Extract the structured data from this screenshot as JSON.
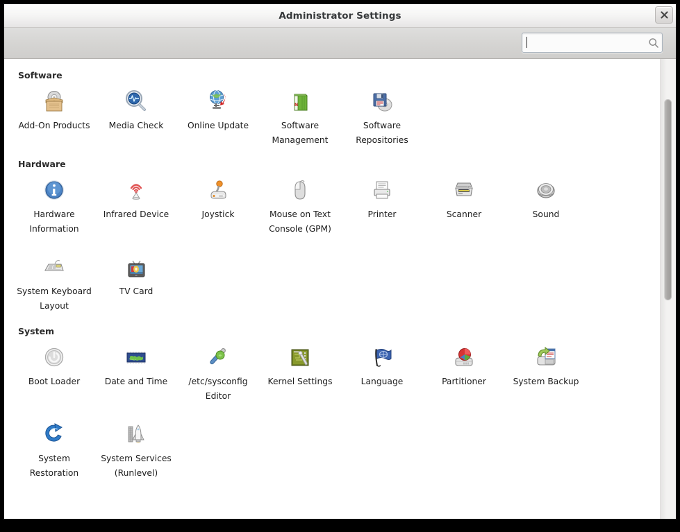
{
  "window": {
    "title": "Administrator Settings",
    "close_label": "x"
  },
  "toolbar": {
    "search": {
      "value": "",
      "placeholder": "",
      "icon": "search-icon"
    }
  },
  "sections": [
    {
      "id": "software",
      "title": "Software",
      "items": [
        {
          "label": "Add-On Products",
          "icon": "package-box-cd-icon"
        },
        {
          "label": "Media Check",
          "icon": "magnifier-pulse-icon"
        },
        {
          "label": "Online Update",
          "icon": "globe-download-icon"
        },
        {
          "label": "Software Management",
          "icon": "green-package-icon"
        },
        {
          "label": "Software Repositories",
          "icon": "floppy-cd-icon"
        }
      ]
    },
    {
      "id": "hardware",
      "title": "Hardware",
      "items": [
        {
          "label": "Hardware Information",
          "icon": "blue-info-icon"
        },
        {
          "label": "Infrared Device",
          "icon": "infrared-waves-icon"
        },
        {
          "label": "Joystick",
          "icon": "joystick-icon"
        },
        {
          "label": "Mouse on Text Console (GPM)",
          "icon": "mouse-icon"
        },
        {
          "label": "Printer",
          "icon": "printer-icon"
        },
        {
          "label": "Scanner",
          "icon": "scanner-icon"
        },
        {
          "label": "Sound",
          "icon": "speaker-icon"
        },
        {
          "label": "System Keyboard Layout",
          "icon": "keyboard-icon"
        },
        {
          "label": "TV Card",
          "icon": "television-icon"
        }
      ]
    },
    {
      "id": "system",
      "title": "System",
      "items": [
        {
          "label": "Boot Loader",
          "icon": "power-button-icon"
        },
        {
          "label": "Date and Time",
          "icon": "world-map-icon"
        },
        {
          "label": "/etc/sysconfig Editor",
          "icon": "wrench-screwdriver-icon"
        },
        {
          "label": "Kernel Settings",
          "icon": "circuit-board-icon"
        },
        {
          "label": "Language",
          "icon": "flag-icon"
        },
        {
          "label": "Partitioner",
          "icon": "harddisk-piechart-icon"
        },
        {
          "label": "System Backup",
          "icon": "harddisk-backup-icon"
        },
        {
          "label": "System Restoration",
          "icon": "blue-refresh-arrow-icon"
        },
        {
          "label": "System Services (Runlevel)",
          "icon": "space-shuttle-icon"
        }
      ]
    }
  ],
  "colors": {
    "window_bg": "#f2f1f0",
    "content_bg": "#ffffff",
    "titlebar_text": "#36393b",
    "accent_blue": "#3465a4",
    "accent_green": "#73b446",
    "accent_red": "#cc0000"
  }
}
